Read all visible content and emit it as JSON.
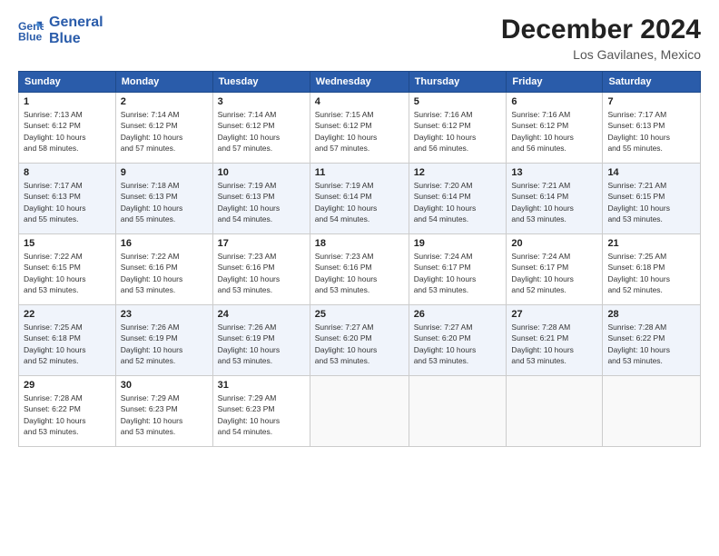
{
  "header": {
    "logo_line1": "General",
    "logo_line2": "Blue",
    "month_title": "December 2024",
    "location": "Los Gavilanes, Mexico"
  },
  "days_of_week": [
    "Sunday",
    "Monday",
    "Tuesday",
    "Wednesday",
    "Thursday",
    "Friday",
    "Saturday"
  ],
  "weeks": [
    [
      {
        "day": "1",
        "info": "Sunrise: 7:13 AM\nSunset: 6:12 PM\nDaylight: 10 hours\nand 58 minutes."
      },
      {
        "day": "2",
        "info": "Sunrise: 7:14 AM\nSunset: 6:12 PM\nDaylight: 10 hours\nand 57 minutes."
      },
      {
        "day": "3",
        "info": "Sunrise: 7:14 AM\nSunset: 6:12 PM\nDaylight: 10 hours\nand 57 minutes."
      },
      {
        "day": "4",
        "info": "Sunrise: 7:15 AM\nSunset: 6:12 PM\nDaylight: 10 hours\nand 57 minutes."
      },
      {
        "day": "5",
        "info": "Sunrise: 7:16 AM\nSunset: 6:12 PM\nDaylight: 10 hours\nand 56 minutes."
      },
      {
        "day": "6",
        "info": "Sunrise: 7:16 AM\nSunset: 6:12 PM\nDaylight: 10 hours\nand 56 minutes."
      },
      {
        "day": "7",
        "info": "Sunrise: 7:17 AM\nSunset: 6:13 PM\nDaylight: 10 hours\nand 55 minutes."
      }
    ],
    [
      {
        "day": "8",
        "info": "Sunrise: 7:17 AM\nSunset: 6:13 PM\nDaylight: 10 hours\nand 55 minutes."
      },
      {
        "day": "9",
        "info": "Sunrise: 7:18 AM\nSunset: 6:13 PM\nDaylight: 10 hours\nand 55 minutes."
      },
      {
        "day": "10",
        "info": "Sunrise: 7:19 AM\nSunset: 6:13 PM\nDaylight: 10 hours\nand 54 minutes."
      },
      {
        "day": "11",
        "info": "Sunrise: 7:19 AM\nSunset: 6:14 PM\nDaylight: 10 hours\nand 54 minutes."
      },
      {
        "day": "12",
        "info": "Sunrise: 7:20 AM\nSunset: 6:14 PM\nDaylight: 10 hours\nand 54 minutes."
      },
      {
        "day": "13",
        "info": "Sunrise: 7:21 AM\nSunset: 6:14 PM\nDaylight: 10 hours\nand 53 minutes."
      },
      {
        "day": "14",
        "info": "Sunrise: 7:21 AM\nSunset: 6:15 PM\nDaylight: 10 hours\nand 53 minutes."
      }
    ],
    [
      {
        "day": "15",
        "info": "Sunrise: 7:22 AM\nSunset: 6:15 PM\nDaylight: 10 hours\nand 53 minutes."
      },
      {
        "day": "16",
        "info": "Sunrise: 7:22 AM\nSunset: 6:16 PM\nDaylight: 10 hours\nand 53 minutes."
      },
      {
        "day": "17",
        "info": "Sunrise: 7:23 AM\nSunset: 6:16 PM\nDaylight: 10 hours\nand 53 minutes."
      },
      {
        "day": "18",
        "info": "Sunrise: 7:23 AM\nSunset: 6:16 PM\nDaylight: 10 hours\nand 53 minutes."
      },
      {
        "day": "19",
        "info": "Sunrise: 7:24 AM\nSunset: 6:17 PM\nDaylight: 10 hours\nand 53 minutes."
      },
      {
        "day": "20",
        "info": "Sunrise: 7:24 AM\nSunset: 6:17 PM\nDaylight: 10 hours\nand 52 minutes."
      },
      {
        "day": "21",
        "info": "Sunrise: 7:25 AM\nSunset: 6:18 PM\nDaylight: 10 hours\nand 52 minutes."
      }
    ],
    [
      {
        "day": "22",
        "info": "Sunrise: 7:25 AM\nSunset: 6:18 PM\nDaylight: 10 hours\nand 52 minutes."
      },
      {
        "day": "23",
        "info": "Sunrise: 7:26 AM\nSunset: 6:19 PM\nDaylight: 10 hours\nand 52 minutes."
      },
      {
        "day": "24",
        "info": "Sunrise: 7:26 AM\nSunset: 6:19 PM\nDaylight: 10 hours\nand 53 minutes."
      },
      {
        "day": "25",
        "info": "Sunrise: 7:27 AM\nSunset: 6:20 PM\nDaylight: 10 hours\nand 53 minutes."
      },
      {
        "day": "26",
        "info": "Sunrise: 7:27 AM\nSunset: 6:20 PM\nDaylight: 10 hours\nand 53 minutes."
      },
      {
        "day": "27",
        "info": "Sunrise: 7:28 AM\nSunset: 6:21 PM\nDaylight: 10 hours\nand 53 minutes."
      },
      {
        "day": "28",
        "info": "Sunrise: 7:28 AM\nSunset: 6:22 PM\nDaylight: 10 hours\nand 53 minutes."
      }
    ],
    [
      {
        "day": "29",
        "info": "Sunrise: 7:28 AM\nSunset: 6:22 PM\nDaylight: 10 hours\nand 53 minutes."
      },
      {
        "day": "30",
        "info": "Sunrise: 7:29 AM\nSunset: 6:23 PM\nDaylight: 10 hours\nand 53 minutes."
      },
      {
        "day": "31",
        "info": "Sunrise: 7:29 AM\nSunset: 6:23 PM\nDaylight: 10 hours\nand 54 minutes."
      },
      {
        "day": "",
        "info": ""
      },
      {
        "day": "",
        "info": ""
      },
      {
        "day": "",
        "info": ""
      },
      {
        "day": "",
        "info": ""
      }
    ]
  ]
}
